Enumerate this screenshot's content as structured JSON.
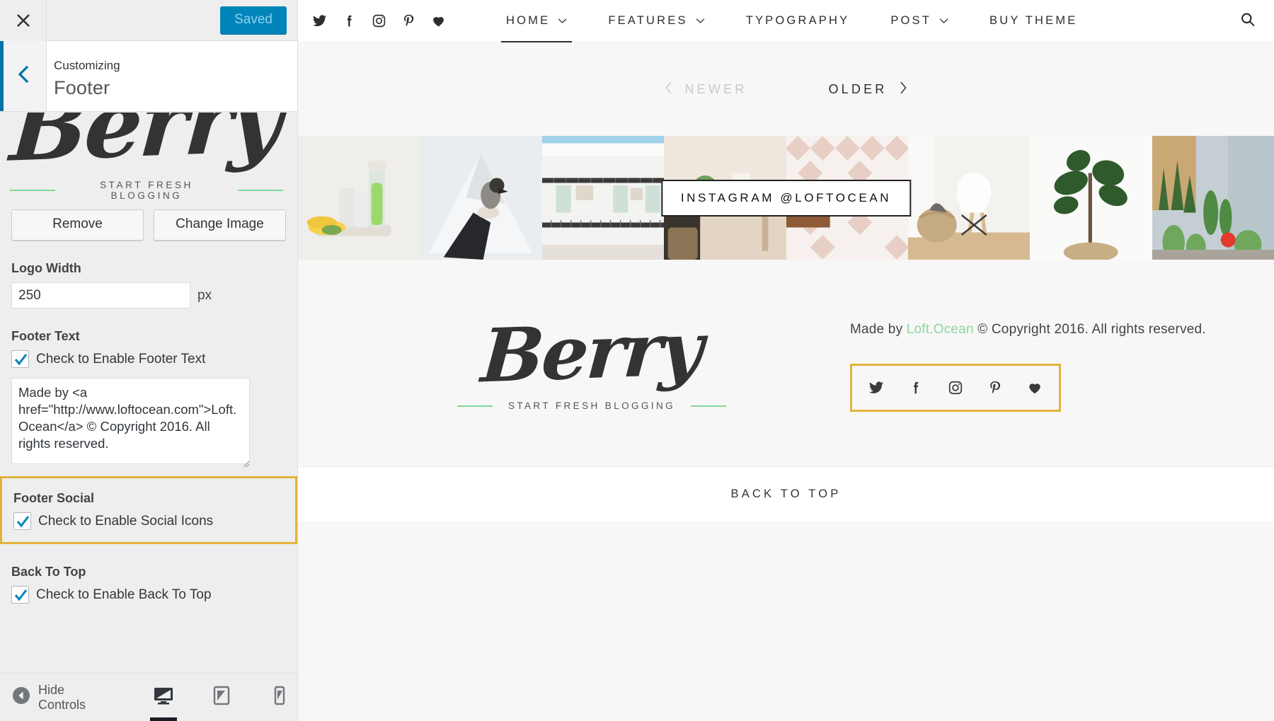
{
  "customizer": {
    "close_icon": "close-icon",
    "save_label": "Saved",
    "back_icon": "chevron-left-icon",
    "customizing_label": "Customizing",
    "section_title": "Footer",
    "logo_preview": {
      "logo_text": "Berry",
      "tagline": "START FRESH BLOGGING"
    },
    "remove_label": "Remove",
    "change_image_label": "Change Image",
    "logo_width": {
      "label": "Logo Width",
      "value": "250",
      "unit": "px"
    },
    "footer_text": {
      "label": "Footer Text",
      "checkbox_label": "Check to Enable Footer Text",
      "checked": true,
      "value": "Made by <a href=\"http://www.loftocean.com\">Loft.Ocean</a> © Copyright 2016. All rights reserved."
    },
    "footer_social": {
      "label": "Footer Social",
      "checkbox_label": "Check to Enable Social Icons",
      "checked": true,
      "highlighted": true,
      "highlight_color": "#e3b23c"
    },
    "back_to_top": {
      "label": "Back To Top",
      "checkbox_label": "Check to Enable Back To Top",
      "checked": true
    },
    "footer_bar": {
      "hide_controls_label": "Hide Controls",
      "hide_controls_icon": "collapse-left-icon",
      "devices": [
        {
          "name": "desktop-icon",
          "label": "Desktop",
          "active": true
        },
        {
          "name": "tablet-icon",
          "label": "Tablet",
          "active": false
        },
        {
          "name": "mobile-icon",
          "label": "Mobile",
          "active": false
        }
      ]
    },
    "accent_color": "#0085ba"
  },
  "preview": {
    "nav_social": [
      {
        "name": "twitter-icon",
        "label": "Twitter"
      },
      {
        "name": "facebook-icon",
        "label": "Facebook"
      },
      {
        "name": "instagram-icon",
        "label": "Instagram"
      },
      {
        "name": "pinterest-icon",
        "label": "Pinterest"
      },
      {
        "name": "bloglovin-heart-icon",
        "label": "Bloglovin"
      }
    ],
    "nav_menu": [
      {
        "label": "HOME",
        "has_dropdown": true,
        "active": true
      },
      {
        "label": "FEATURES",
        "has_dropdown": true,
        "active": false
      },
      {
        "label": "TYPOGRAPHY",
        "has_dropdown": false,
        "active": false
      },
      {
        "label": "POST",
        "has_dropdown": true,
        "active": false
      },
      {
        "label": "BUY THEME",
        "has_dropdown": false,
        "active": false
      }
    ],
    "search_icon": "search-icon",
    "pagination": {
      "newer_label": "NEWER",
      "newer_disabled": true,
      "older_label": "OLDER",
      "older_disabled": false
    },
    "instagram": {
      "badge_label": "INSTAGRAM @LOFTOCEAN",
      "tiles": [
        {
          "alt": "bottle-of-green-juice-with-fruit"
        },
        {
          "alt": "bird-perched-on-hand-in-snow"
        },
        {
          "alt": "white-apartment-balconies"
        },
        {
          "alt": "plant-on-table-in-bright-room"
        },
        {
          "alt": "pink-geometric-pattern-wall"
        },
        {
          "alt": "white-chair-and-woven-basket"
        },
        {
          "alt": "fiddle-leaf-fig-tree"
        },
        {
          "alt": "cacti-and-succulents-by-window"
        }
      ]
    },
    "footer": {
      "logo_text": "Berry",
      "tagline": "START FRESH BLOGGING",
      "copyright_prefix": "Made by ",
      "copyright_link": "Loft.Ocean",
      "copyright_suffix": " © Copyright 2016. All rights reserved.",
      "link_color": "#8fd69e",
      "social": [
        {
          "name": "twitter-icon",
          "label": "Twitter"
        },
        {
          "name": "facebook-icon",
          "label": "Facebook"
        },
        {
          "name": "instagram-icon",
          "label": "Instagram"
        },
        {
          "name": "pinterest-icon",
          "label": "Pinterest"
        },
        {
          "name": "bloglovin-heart-icon",
          "label": "Bloglovin"
        }
      ],
      "highlighted": true,
      "highlight_color": "#e3b23c"
    },
    "back_to_top_label": "BACK TO TOP"
  }
}
